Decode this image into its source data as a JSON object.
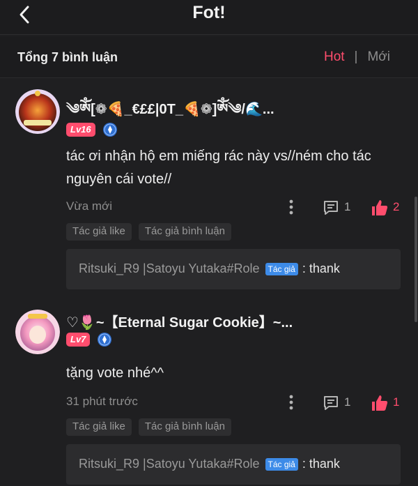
{
  "header": {
    "title": "Fot!",
    "back_icon": "chevron-left-icon"
  },
  "subheader": {
    "total": "Tổng 7 bình luận",
    "sort_hot": "Hot",
    "sort_separator": "|",
    "sort_new": "Mới"
  },
  "colors": {
    "accent": "#ff4d6d",
    "background": "#1f1f21",
    "author_tag": "#3d8be8"
  },
  "comments": [
    {
      "username": "༄ༀ[❁🍕_€££|0T_🍕❁]ༀ༄/🌊...",
      "level": "Lv16",
      "text": "tác ơi nhận hộ em miếng rác này vs//ném cho tác nguyên cái vote//",
      "time": "Vừa mới",
      "reply_count": "1",
      "like_count": "2",
      "tags": [
        "Tác giả like",
        "Tác giả bình luận"
      ],
      "reply": {
        "user": "Ritsuki_R9 |Satoyu Yutaka#Role",
        "author_label": "Tác giả",
        "message": ": thank"
      }
    },
    {
      "username": "♡🌷~【Eternal Sugar Cookie】~...",
      "level": "Lv7",
      "text": "tặng vote nhé^^",
      "time": "31 phút trước",
      "reply_count": "1",
      "like_count": "1",
      "tags": [
        "Tác giả like",
        "Tác giả bình luận"
      ],
      "reply": {
        "user": "Ritsuki_R9 |Satoyu Yutaka#Role",
        "author_label": "Tác giả",
        "message": ": thank"
      }
    }
  ]
}
